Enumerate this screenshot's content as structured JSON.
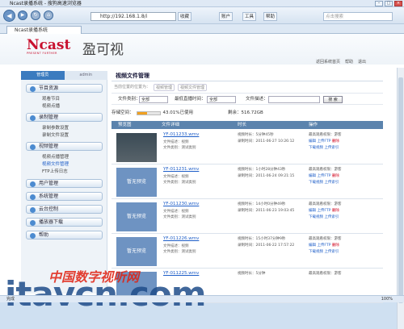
{
  "window": {
    "title": "Ncast录播系统 - 搜狗高速浏览器"
  },
  "toolbar": {
    "address": "http://192.168.1.8/i",
    "fav": "收藏",
    "account": "账户",
    "tools": "工具",
    "help": "帮助",
    "search_placeholder": "点击搜索"
  },
  "tab": {
    "label": "Ncast录播系统"
  },
  "header": {
    "logo": "Ncast",
    "logo_sub": "PRESENT FURTHER",
    "logo_cn": "盈可视",
    "links": [
      "返回系统首页",
      "帮助",
      "退出"
    ]
  },
  "sidebar": {
    "tabs": [
      "管理员",
      "admin"
    ],
    "sections": [
      {
        "label": "节目资源",
        "items": [
          "观看节目",
          "视频点播"
        ]
      },
      {
        "label": "录制管理",
        "items": [
          "录制参数设置",
          "录制文件设置"
        ]
      },
      {
        "label": "视频管理",
        "items": [
          "视频点播管理",
          "视频文件管理",
          "FTP上传日志"
        ]
      },
      {
        "label": "用户管理",
        "items": []
      },
      {
        "label": "系统管理",
        "items": []
      },
      {
        "label": "云台控制",
        "items": []
      },
      {
        "label": "播放器下载",
        "items": []
      },
      {
        "label": "帮助",
        "items": []
      }
    ]
  },
  "content": {
    "title": "视频文件管理",
    "breadcrumb": [
      "当前位置的位置为：",
      "视频管理",
      "视频文件管理"
    ],
    "filter": {
      "type_label": "文件类别：",
      "type_value": "全部",
      "period_label": "最低直播时间：",
      "period_value": "全部",
      "desc_label": "文件描述：",
      "desc_value": "",
      "search": "搜 索"
    },
    "storage": {
      "label": "存储空间：",
      "used_text": "43.01%已使用",
      "fraction": 0.4301,
      "total": "剩余：516.72GB"
    },
    "columns": [
      "预览图",
      "文件详细",
      "时长",
      "操作"
    ],
    "rows": [
      {
        "thumb": "",
        "thumb_photo": true,
        "name": "YF-011233.wmv",
        "desc1": "文件描述：视频",
        "desc2": "文件类别：测试类别",
        "duration": "视频时长：5分钟45秒",
        "created": "录制时间：2011-06-27 10:26:12",
        "line1": "最高观看权限：游客",
        "ops": [
          "编辑",
          "上传FTP",
          "删除"
        ],
        "ops2": [
          "下载视频",
          "上传索引"
        ]
      },
      {
        "thumb": "暂无预览",
        "thumb_photo": false,
        "name": "YF-011231.wmv",
        "desc1": "文件描述：视频",
        "desc2": "文件类别：测试类别",
        "duration": "视频时长：1小时28分钟43秒",
        "created": "录制时间：2011-06-24 09:21:15",
        "line1": "最高观看权限：游客",
        "ops": [
          "编辑",
          "上传FTP",
          "删除"
        ],
        "ops2": [
          "下载视频",
          "上传索引"
        ]
      },
      {
        "thumb": "暂无预览",
        "thumb_photo": false,
        "name": "YF-011230.wmv",
        "desc1": "文件描述：视频",
        "desc2": "文件类别：测试类别",
        "duration": "视频时长：14小时0分钟49秒",
        "created": "录制时间：2011-06-23 19:03:45",
        "line1": "最高观看权限：游客",
        "ops": [
          "编辑",
          "上传FTP",
          "删除"
        ],
        "ops2": [
          "下载视频",
          "上传索引"
        ]
      },
      {
        "thumb": "暂无预览",
        "thumb_photo": false,
        "name": "YF-011226.wmv",
        "desc1": "文件描述：视频",
        "desc2": "文件类别：测试类别",
        "duration": "视频时长：15小时37分钟9秒",
        "created": "录制时间：2011-06-22 17:57:22",
        "line1": "最高观看权限：游客",
        "ops": [
          "编辑",
          "上传FTP",
          "删除"
        ],
        "ops2": [
          "下载视频",
          "上传索引"
        ]
      },
      {
        "thumb": "",
        "thumb_photo": false,
        "name": "YF-011225.wmv",
        "desc1": "",
        "desc2": "",
        "duration": "视频时长：5分钟",
        "created": "",
        "line1": "最高观看权限：游客",
        "ops": [],
        "ops2": []
      }
    ]
  },
  "watermark": {
    "cn": "中国数字视听网",
    "en": "itavcn.com"
  },
  "status": {
    "text": "完成",
    "zoom": "100%"
  }
}
